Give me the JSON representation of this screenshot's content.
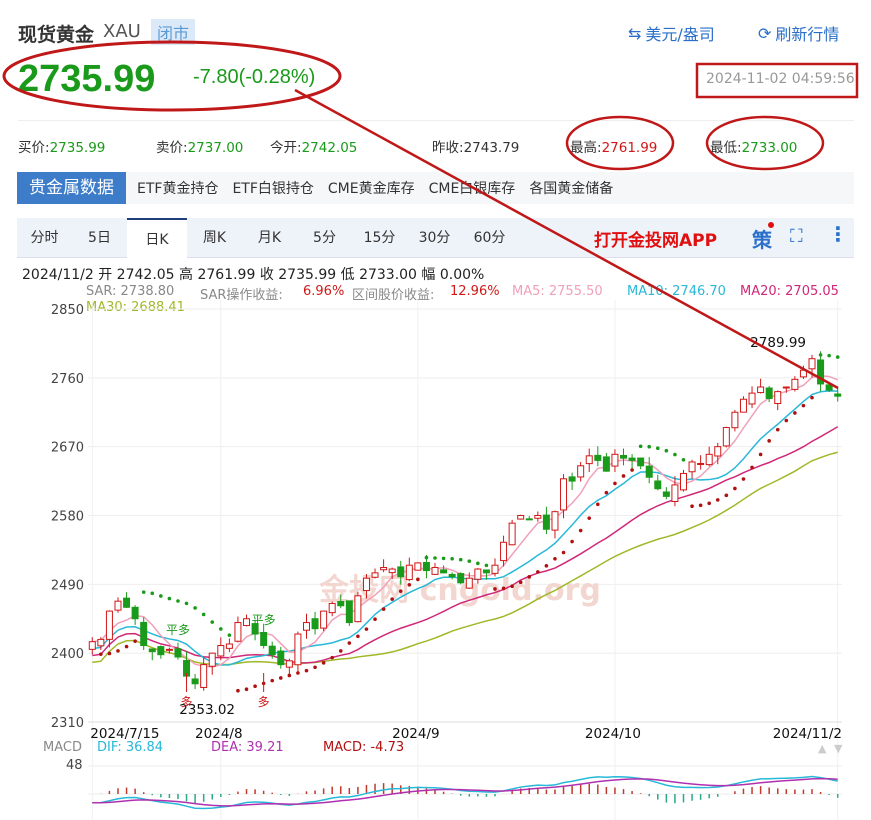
{
  "header": {
    "title": "现货黄金",
    "code": "XAU",
    "status": "闭市",
    "currency_link": "美元/盎司",
    "refresh_link": "刷新行情"
  },
  "quote": {
    "price": "2735.99",
    "change": "-7.80(-0.28%)",
    "time": "2024-11-02 04:59:56"
  },
  "stats": [
    {
      "label": "买价:",
      "value": "2735.99",
      "color": "g"
    },
    {
      "label": "卖价:",
      "value": "2737.00",
      "color": "g"
    },
    {
      "label": "今开:",
      "value": "2742.05",
      "color": "g"
    },
    {
      "label": "昨收:",
      "value": "2743.79",
      "color": ""
    },
    {
      "label": "最高:",
      "value": "2761.99",
      "color": "r"
    },
    {
      "label": "最低:",
      "value": "2733.00",
      "color": "g"
    }
  ],
  "data_tabs": [
    "贵金属数据",
    "ETF黄金持仓",
    "ETF白银持仓",
    "CME黄金库存",
    "CME白银库存",
    "各国黄金储备"
  ],
  "period_tabs": [
    "分时",
    "5日",
    "日K",
    "周K",
    "月K",
    "5分",
    "15分",
    "30分",
    "60分"
  ],
  "active_period": "日K",
  "app_link": "打开金投网APP",
  "strategy_icon": "策",
  "info_line": "2024/11/2 开 2742.05 高 2761.99 收 2735.99 低 2733.00 幅 0.00%",
  "indicators": {
    "sar": "SAR: 2738.80",
    "sar_label": "SAR操作收益:",
    "sar_gain": "6.96%",
    "range_label": "区间股价收益:",
    "range_gain": "12.96%",
    "ma5": "MA5: 2755.50",
    "ma10": "MA10: 2746.70",
    "ma20": "MA20: 2705.05",
    "ma30": "MA30: 2688.41"
  },
  "colors": {
    "up": "#d01818",
    "down": "#1a9a1a",
    "ma5": "#f0a0b8",
    "ma10": "#28b8d8",
    "ma20": "#d02878",
    "ma30": "#a0b828",
    "sar": "#b01010",
    "dif": "#28b8d8",
    "dea": "#b030b0"
  },
  "watermark": "金投网 cngold.org",
  "chart_data": {
    "type": "candlestick",
    "yticks": [
      2850,
      2760,
      2670,
      2580,
      2490,
      2400,
      2310
    ],
    "ylim": [
      2310,
      2850
    ],
    "closes": [
      2415,
      2418,
      2455,
      2468,
      2460,
      2445,
      2410,
      2402,
      2398,
      2405,
      2395,
      2370,
      2360,
      2385,
      2400,
      2410,
      2412,
      2440,
      2445,
      2425,
      2410,
      2398,
      2385,
      2390,
      2425,
      2440,
      2432,
      2455,
      2465,
      2462,
      2440,
      2475,
      2498,
      2505,
      2512,
      2510,
      2500,
      2515,
      2518,
      2508,
      2512,
      2505,
      2500,
      2492,
      2498,
      2510,
      2505,
      2515,
      2545,
      2570,
      2580,
      2575,
      2580,
      2562,
      2585,
      2628,
      2625,
      2645,
      2658,
      2652,
      2638,
      2660,
      2655,
      2652,
      2645,
      2630,
      2615,
      2605,
      2620,
      2635,
      2650,
      2648,
      2660,
      2670,
      2695,
      2715,
      2732,
      2740,
      2748,
      2733,
      2742,
      2748,
      2758,
      2770,
      2785,
      2752,
      2744,
      2736
    ],
    "xlabels": [
      {
        "label": "2024/7/15",
        "index": 0
      },
      {
        "label": "2024/8",
        "index": 15
      },
      {
        "label": "2024/9",
        "index": 38
      },
      {
        "label": "2024/10",
        "index": 61
      },
      {
        "label": "2024/11/2",
        "index": 87
      }
    ],
    "high_label": {
      "text": "2789.99",
      "index": 84,
      "value": 2789.99
    },
    "low_label": {
      "text": "2353.02",
      "index": 12,
      "value": 2353.02
    },
    "signals": [
      {
        "text": "平多",
        "index": 10
      },
      {
        "text": "平多",
        "index": 20
      },
      {
        "text": "多",
        "index": 11
      },
      {
        "text": "多",
        "index": 20
      }
    ],
    "macd": {
      "label": "MACD",
      "dif": "DIF: 36.84",
      "dea": "DEA: 39.21",
      "macd": "MACD: -4.73",
      "ytick": "48"
    }
  }
}
